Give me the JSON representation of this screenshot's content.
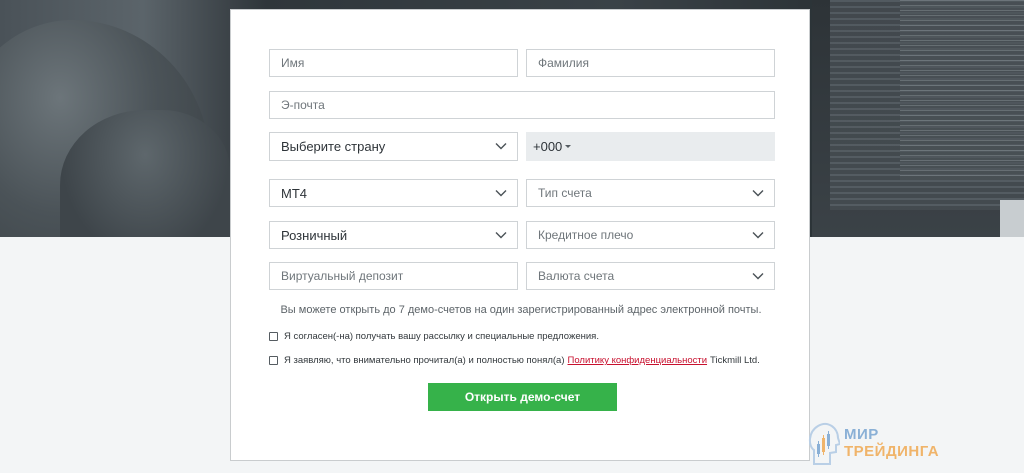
{
  "form": {
    "first_name_placeholder": "Имя",
    "last_name_placeholder": "Фамилия",
    "email_placeholder": "Э-почта",
    "country_select": "Выберите страну",
    "phone_code": "+000",
    "platform_select": "MT4",
    "account_type_select": "Тип счета",
    "client_type_select": "Розничный",
    "leverage_select": "Кредитное плечо",
    "virtual_deposit_placeholder": "Виртуальный депозит",
    "currency_select": "Валюта счета",
    "note": "Вы можете открыть до 7 демо-счетов на один зарегистрированный адрес электронной почты.",
    "consent_1": "Я согласен(-на) получать вашу рассылку и специальные предложения.",
    "consent_2_before": "Я заявляю, что внимательно прочитал(а) и полностью понял(а)",
    "consent_2_link": "Политику конфиденциальности",
    "consent_2_after": "Tickmill Ltd.",
    "submit_label": "Открыть демо-счет"
  },
  "watermark": {
    "line1": "МИР",
    "line2": "ТРЕЙДИНГА"
  },
  "colors": {
    "accent_green": "#36b24a",
    "link_red": "#c8102e"
  }
}
